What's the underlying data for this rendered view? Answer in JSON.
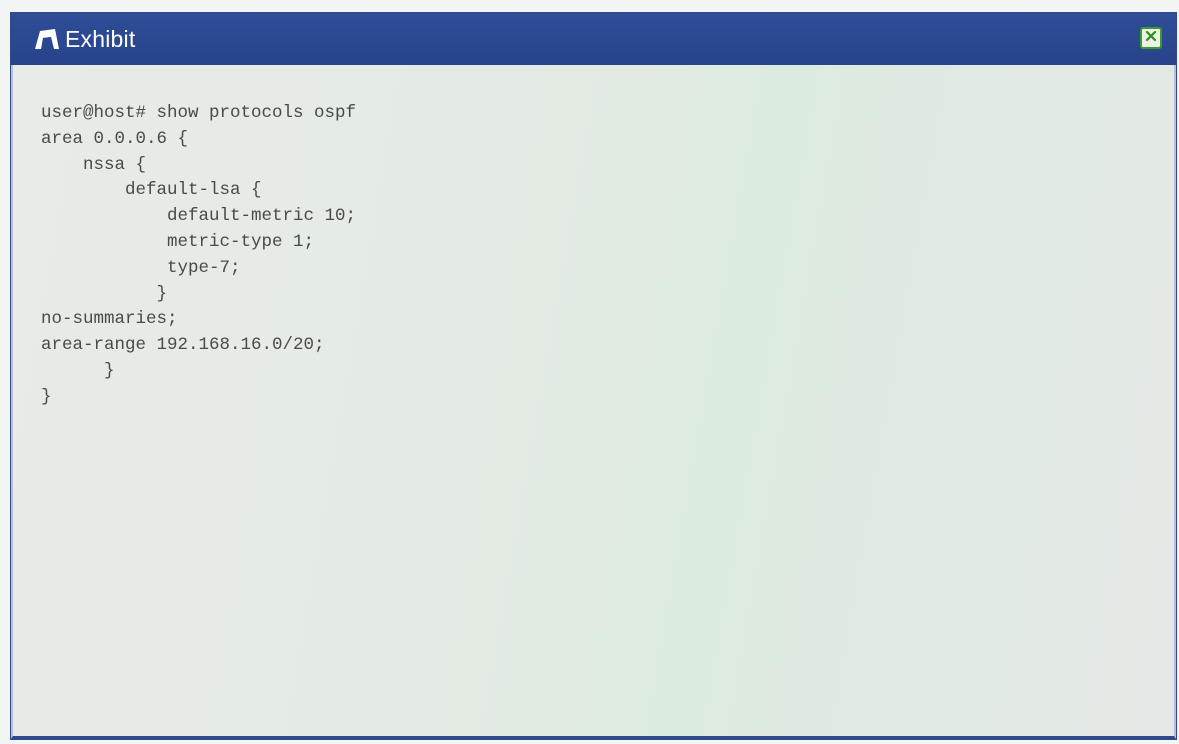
{
  "window": {
    "title": "Exhibit",
    "title_icon": "exhibit-icon",
    "close_icon": "close-icon",
    "colors": {
      "titlebar": "#2b4890",
      "title_text": "#ffffff",
      "close_accent": "#3a9a2a",
      "code_text": "#4a4a4a"
    }
  },
  "code": {
    "lines": [
      "user@host# show protocols ospf",
      "area 0.0.0.6 {",
      "    nssa {",
      "        default-lsa {",
      "            default-metric 10;",
      "            metric-type 1;",
      "            type-7;",
      "           }",
      "no-summaries;",
      "area-range 192.168.16.0/20;",
      "      }",
      "}"
    ]
  }
}
